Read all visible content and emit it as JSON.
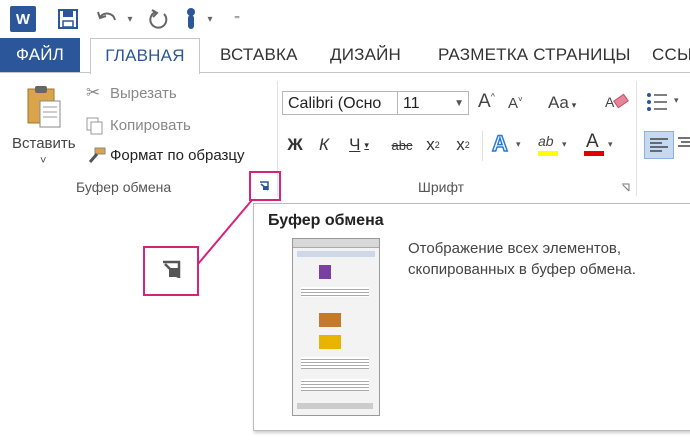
{
  "qat": {
    "app_icon": "word-logo",
    "logo_letter": "W",
    "icons": [
      "save-icon",
      "undo-icon",
      "redo-icon",
      "touch-mode-icon",
      "customize-icon"
    ]
  },
  "tabs": {
    "file": "ФАЙЛ",
    "home": "ГЛАВНАЯ",
    "insert": "ВСТАВКА",
    "design": "ДИЗАЙН",
    "layout": "РАЗМЕТКА СТРАНИЦЫ",
    "refs": "ССЫ"
  },
  "clipboard": {
    "paste": "Вставить",
    "paste_arrow": "˅",
    "cut": "Вырезать",
    "copy": "Копировать",
    "format_painter": "Формат по образцу",
    "group_label": "Буфер обмена"
  },
  "font": {
    "font_name": "Calibri (Осно",
    "font_size": "11",
    "group_label": "Шрифт",
    "bold": "Ж",
    "italic": "К",
    "underline": "Ч",
    "strike": "abc",
    "sub": "x",
    "sub_mark": "2",
    "sup": "x",
    "sup_mark": "2",
    "grow": "A",
    "shrink": "A",
    "case": "Aa",
    "effects": "A",
    "font_color": "A",
    "highlight": "ab"
  },
  "tooltip": {
    "title": "Буфер обмена",
    "description": "Отображение всех элементов, скопированных в буфер обмена."
  },
  "colors": {
    "accent": "#2b579a",
    "highlight_frame": "#d4237a",
    "font_color_bar": "#e00000",
    "highlight_bar": "#ffff00"
  }
}
